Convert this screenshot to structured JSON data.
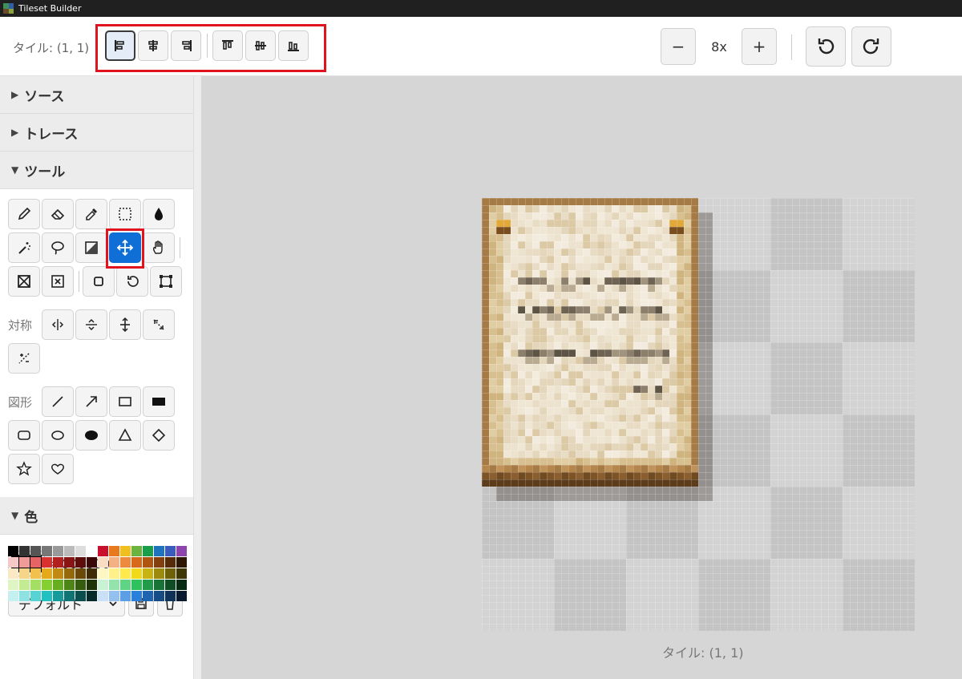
{
  "window": {
    "title": "Tileset Builder"
  },
  "toolbar": {
    "tile_label": "タイル: (1, 1)",
    "zoom_level": "8x",
    "zoom_out_label": "−",
    "zoom_in_label": "+",
    "align_buttons": [
      "align-left",
      "align-center-horizontal",
      "align-right",
      "align-top",
      "align-middle-vertical",
      "align-bottom"
    ]
  },
  "sidebar": {
    "sections": {
      "source": {
        "label": "ソース",
        "expanded": false
      },
      "trace": {
        "label": "トレース",
        "expanded": false
      },
      "tools": {
        "label": "ツール",
        "expanded": true
      },
      "color": {
        "label": "色",
        "expanded": true
      }
    },
    "symmetry_label": "対称",
    "shapes_label": "図形",
    "selected_tool": "move-icon",
    "current_color": "#000000",
    "palette_name": "デフォルト",
    "palette_colors": [
      "#000000",
      "#333333",
      "#555555",
      "#777777",
      "#999999",
      "#bbbbbb",
      "#dddddd",
      "#ffffff",
      "#c8102e",
      "#e87a1d",
      "#f0c020",
      "#6db33f",
      "#1a9e4a",
      "#1e73be",
      "#3b5bbf",
      "#8e44ad",
      "#f6c9c9",
      "#f19a9a",
      "#e66464",
      "#d93030",
      "#b21f1f",
      "#8a1414",
      "#5e0d0d",
      "#3a0707",
      "#f9dcc4",
      "#f4b183",
      "#ed8a3f",
      "#d9691a",
      "#b05412",
      "#83400e",
      "#572a09",
      "#2e1605",
      "#fbe8c4",
      "#f7d588",
      "#f2c14d",
      "#e6a91a",
      "#c28a12",
      "#96680c",
      "#6a4808",
      "#3e2a04",
      "#fff7c2",
      "#fff08a",
      "#ffe94d",
      "#f2d91a",
      "#c9b312",
      "#9c8a0c",
      "#6e6108",
      "#403804",
      "#dff5c4",
      "#c3eb94",
      "#a3df63",
      "#84d033",
      "#66ad1f",
      "#4d8516",
      "#355c0f",
      "#1d3308",
      "#c9f2d5",
      "#94e3ad",
      "#5fd485",
      "#2fc15e",
      "#219b49",
      "#187436",
      "#0f4e24",
      "#072a13",
      "#c4f0f0",
      "#8ee2e2",
      "#57d3d3",
      "#22c0c0",
      "#189a9a",
      "#117474",
      "#0b4e4e",
      "#052a2a",
      "#c9e0f7",
      "#93c0ef",
      "#5d9fe6",
      "#2a7fdb",
      "#1f64b0",
      "#174b85",
      "#0f325a",
      "#071a2f"
    ]
  },
  "canvas": {
    "caption": "タイル: (1, 1)"
  }
}
